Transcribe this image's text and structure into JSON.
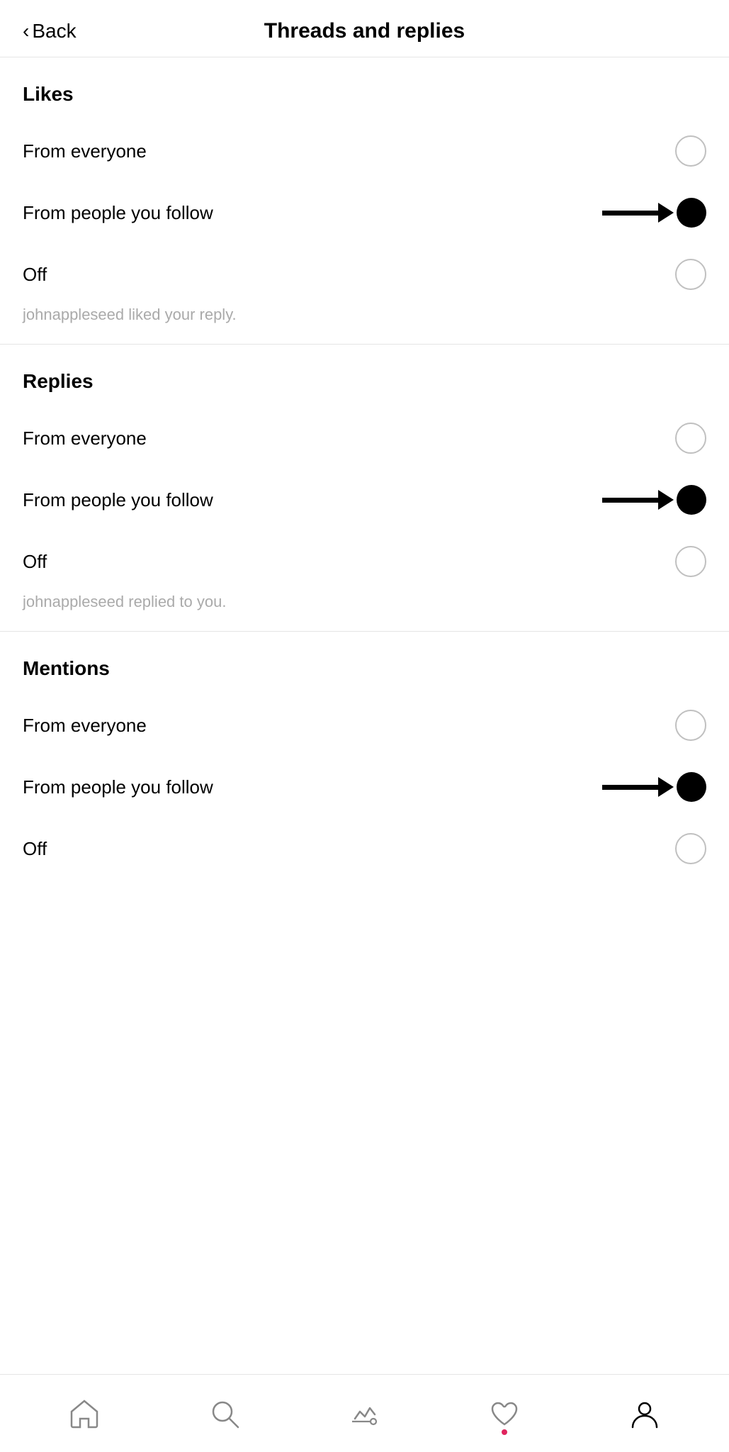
{
  "header": {
    "back_label": "Back",
    "title": "Threads and replies"
  },
  "sections": [
    {
      "id": "likes",
      "title": "Likes",
      "options": [
        {
          "id": "likes-everyone",
          "label": "From everyone",
          "selected": false
        },
        {
          "id": "likes-follow",
          "label": "From people you follow",
          "selected": true
        },
        {
          "id": "likes-off",
          "label": "Off",
          "selected": false
        }
      ],
      "preview": "johnappleseed liked your reply."
    },
    {
      "id": "replies",
      "title": "Replies",
      "options": [
        {
          "id": "replies-everyone",
          "label": "From everyone",
          "selected": false
        },
        {
          "id": "replies-follow",
          "label": "From people you follow",
          "selected": true
        },
        {
          "id": "replies-off",
          "label": "Off",
          "selected": false
        }
      ],
      "preview": "johnappleseed replied to you."
    },
    {
      "id": "mentions",
      "title": "Mentions",
      "options": [
        {
          "id": "mentions-everyone",
          "label": "From everyone",
          "selected": false
        },
        {
          "id": "mentions-follow",
          "label": "From people you follow",
          "selected": true
        },
        {
          "id": "mentions-off",
          "label": "Off",
          "selected": false
        }
      ],
      "preview": null
    }
  ],
  "nav": {
    "items": [
      {
        "id": "home",
        "label": "Home"
      },
      {
        "id": "search",
        "label": "Search"
      },
      {
        "id": "activity",
        "label": "Activity"
      },
      {
        "id": "likes",
        "label": "Likes"
      },
      {
        "id": "profile",
        "label": "Profile"
      }
    ]
  }
}
